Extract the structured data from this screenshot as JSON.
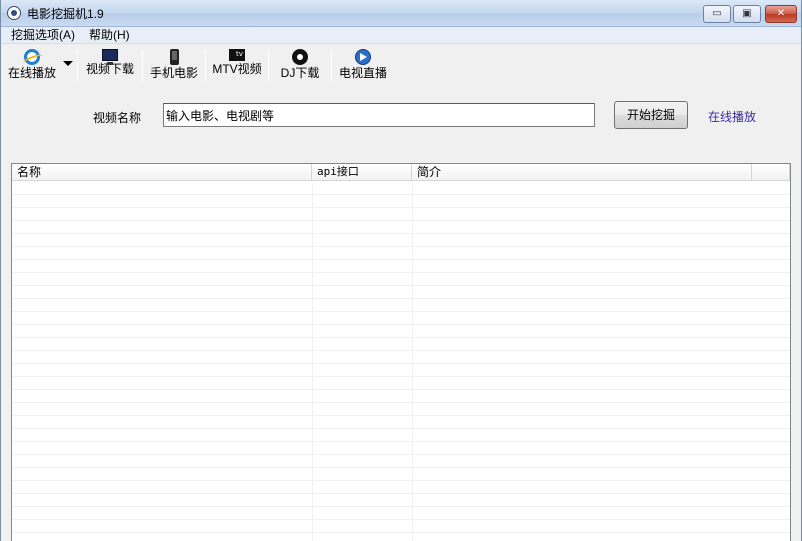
{
  "window": {
    "title": "电影挖掘机1.9",
    "min_label": "▭",
    "max_label": "▣",
    "close_label": "✕"
  },
  "menu": {
    "items": [
      {
        "label": "挖掘选项(A)"
      },
      {
        "label": "帮助(H)"
      }
    ]
  },
  "toolbar": {
    "items": [
      {
        "label": "在线播放",
        "icon": "ie-icon"
      },
      {
        "label": "视频下载",
        "icon": "monitor-icon"
      },
      {
        "label": "手机电影",
        "icon": "phone-icon"
      },
      {
        "label": "MTV视频",
        "icon": "mtv-icon"
      },
      {
        "label": "DJ下载",
        "icon": "dj-disc-icon"
      },
      {
        "label": "电视直播",
        "icon": "tv-live-icon"
      }
    ]
  },
  "search": {
    "label": "视频名称",
    "value": "输入电影、电视剧等",
    "button_label": "开始挖掘",
    "link_label": "在线播放"
  },
  "list": {
    "columns": [
      {
        "label": "名称"
      },
      {
        "label": "api接口"
      },
      {
        "label": "简介"
      },
      {
        "label": ""
      }
    ],
    "rows": []
  },
  "colors": {
    "link": "#3b2ca5",
    "title_bar": "#c4d7ef",
    "close_button": "#c75a45"
  }
}
